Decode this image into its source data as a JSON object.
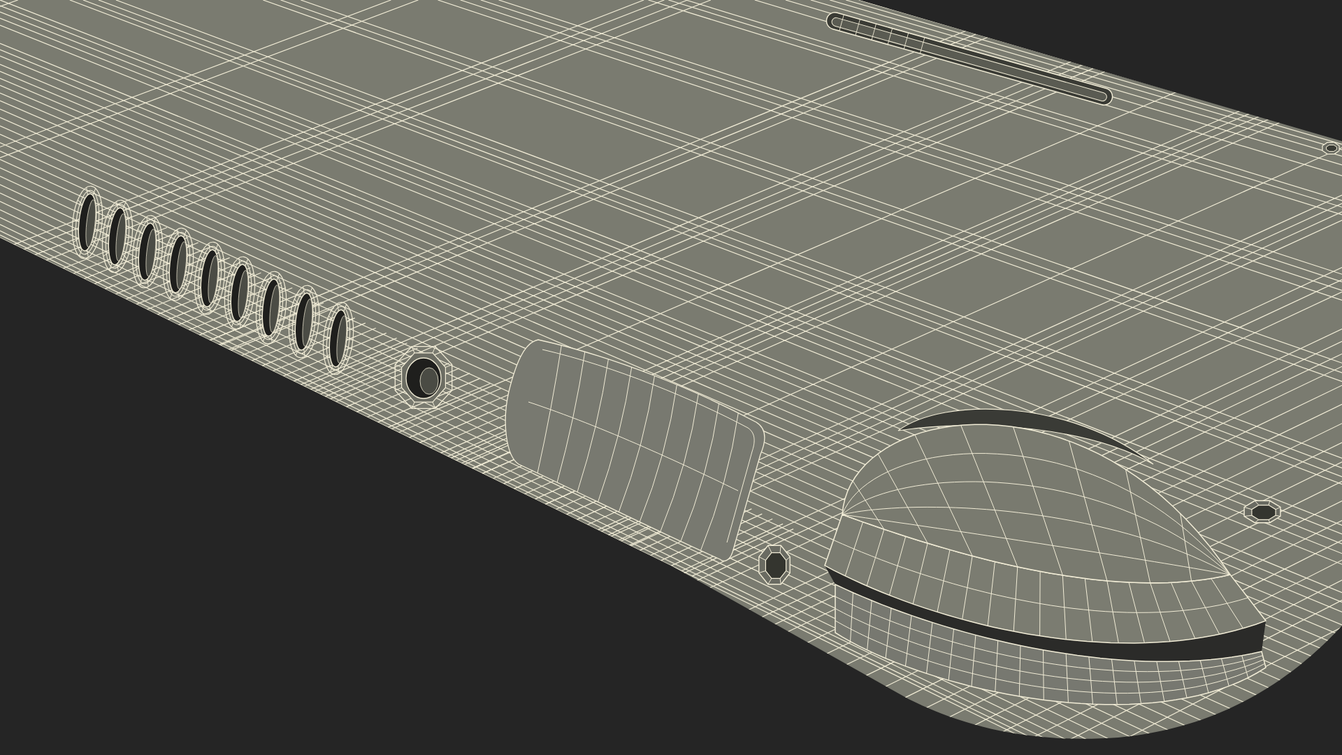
{
  "render": {
    "kind": "wireframe",
    "parts": [
      {
        "kind": "top-slot"
      },
      {
        "kind": "mic-hole"
      },
      {
        "kind": "speaker-slot"
      },
      {
        "kind": "speaker-slot"
      },
      {
        "kind": "speaker-slot"
      },
      {
        "kind": "speaker-slot"
      },
      {
        "kind": "speaker-slot"
      },
      {
        "kind": "speaker-slot"
      },
      {
        "kind": "speaker-slot"
      },
      {
        "kind": "speaker-slot"
      },
      {
        "kind": "speaker-slot"
      },
      {
        "kind": "audio-jack"
      },
      {
        "kind": "port-cover"
      },
      {
        "kind": "screw-hole"
      },
      {
        "kind": "end-cap"
      },
      {
        "kind": "screw-hole"
      }
    ]
  }
}
